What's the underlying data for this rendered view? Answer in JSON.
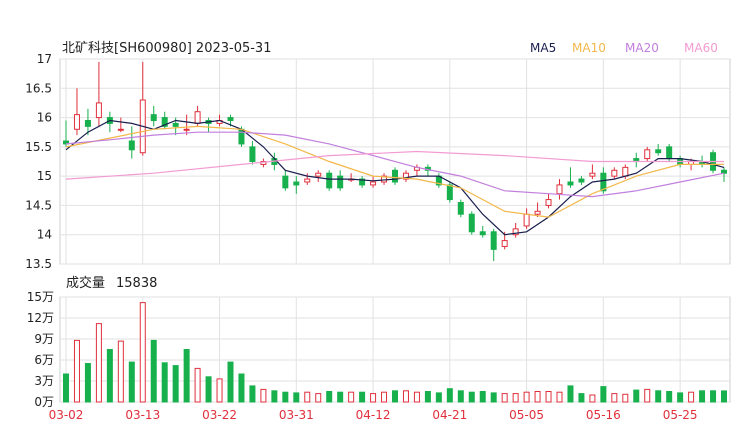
{
  "header": {
    "title": "北矿科技[SH600980] 2023-05-31",
    "legend": [
      {
        "label": "MA5",
        "color": "#1a1f4e"
      },
      {
        "label": "MA10",
        "color": "#f2b84b"
      },
      {
        "label": "MA20",
        "color": "#c27fde"
      },
      {
        "label": "MA60",
        "color": "#f39bd3"
      }
    ]
  },
  "volume_header": {
    "label": "成交量",
    "value": "15838"
  },
  "x_tick_labels": [
    "03-02",
    "03-13",
    "03-22",
    "03-31",
    "04-12",
    "04-21",
    "05-05",
    "05-16",
    "05-25"
  ],
  "colors": {
    "up": "#e0303c",
    "down": "#17b04d",
    "grid": "#e2e2e2",
    "axis": "#222222",
    "date_label": "#e0303c"
  },
  "chart_data": [
    {
      "type": "candlestick",
      "ylim": [
        13.5,
        17
      ],
      "yticks": [
        17,
        16.5,
        16,
        15.5,
        15,
        14.5,
        14,
        13.5
      ],
      "dates": [
        "03-02",
        "03-03",
        "03-06",
        "03-07",
        "03-08",
        "03-09",
        "03-10",
        "03-13",
        "03-14",
        "03-15",
        "03-16",
        "03-17",
        "03-20",
        "03-21",
        "03-22",
        "03-23",
        "03-24",
        "03-27",
        "03-28",
        "03-29",
        "03-30",
        "03-31",
        "04-03",
        "04-04",
        "04-06",
        "04-07",
        "04-10",
        "04-11",
        "04-12",
        "04-13",
        "04-14",
        "04-17",
        "04-18",
        "04-19",
        "04-20",
        "04-21",
        "04-24",
        "04-25",
        "04-26",
        "04-27",
        "04-28",
        "05-04",
        "05-05",
        "05-08",
        "05-09",
        "05-10",
        "05-11",
        "05-12",
        "05-15",
        "05-16",
        "05-17",
        "05-18",
        "05-19",
        "05-22",
        "05-23",
        "05-24",
        "05-25",
        "05-26",
        "05-29",
        "05-30",
        "05-31"
      ],
      "candles": [
        [
          15.6,
          15.55,
          15.95,
          15.5
        ],
        [
          15.8,
          16.05,
          16.5,
          15.7
        ],
        [
          15.95,
          15.85,
          16.15,
          15.7
        ],
        [
          16.0,
          16.25,
          16.95,
          15.85
        ],
        [
          16.0,
          15.9,
          16.1,
          15.75
        ],
        [
          15.8,
          15.8,
          16.0,
          15.75
        ],
        [
          15.6,
          15.45,
          15.85,
          15.3
        ],
        [
          15.4,
          16.3,
          16.95,
          15.35
        ],
        [
          16.05,
          15.95,
          16.2,
          15.85
        ],
        [
          16.0,
          15.85,
          16.1,
          15.8
        ],
        [
          15.9,
          15.85,
          16.0,
          15.7
        ],
        [
          15.8,
          15.8,
          16.05,
          15.7
        ],
        [
          15.9,
          16.1,
          16.2,
          15.85
        ],
        [
          15.95,
          15.9,
          16.0,
          15.75
        ],
        [
          15.9,
          15.95,
          16.05,
          15.85
        ],
        [
          16.0,
          15.95,
          16.05,
          15.85
        ],
        [
          15.8,
          15.55,
          15.85,
          15.5
        ],
        [
          15.5,
          15.25,
          15.6,
          15.2
        ],
        [
          15.2,
          15.25,
          15.3,
          15.15
        ],
        [
          15.3,
          15.2,
          15.4,
          15.1
        ],
        [
          15.0,
          14.8,
          15.1,
          14.75
        ],
        [
          14.9,
          14.85,
          15.0,
          14.7
        ],
        [
          14.9,
          14.95,
          15.05,
          14.85
        ],
        [
          15.0,
          15.05,
          15.1,
          14.9
        ],
        [
          15.05,
          14.8,
          15.1,
          14.75
        ],
        [
          15.0,
          14.8,
          15.1,
          14.75
        ],
        [
          14.95,
          14.95,
          15.05,
          14.9
        ],
        [
          14.95,
          14.85,
          15.0,
          14.8
        ],
        [
          14.85,
          14.9,
          15.0,
          14.8
        ],
        [
          14.9,
          15.0,
          15.05,
          14.85
        ],
        [
          15.1,
          14.9,
          15.15,
          14.85
        ],
        [
          14.95,
          15.05,
          15.1,
          14.9
        ],
        [
          15.1,
          15.15,
          15.2,
          15.0
        ],
        [
          15.15,
          15.1,
          15.2,
          15.0
        ],
        [
          15.0,
          14.85,
          15.05,
          14.8
        ],
        [
          14.85,
          14.6,
          14.9,
          14.55
        ],
        [
          14.55,
          14.35,
          14.6,
          14.3
        ],
        [
          14.35,
          14.05,
          14.4,
          14.0
        ],
        [
          14.05,
          14.0,
          14.15,
          13.95
        ],
        [
          14.05,
          13.75,
          14.1,
          13.55
        ],
        [
          13.8,
          13.9,
          14.05,
          13.75
        ],
        [
          14.0,
          14.1,
          14.2,
          13.95
        ],
        [
          14.15,
          14.35,
          14.45,
          14.1
        ],
        [
          14.35,
          14.4,
          14.55,
          14.3
        ],
        [
          14.5,
          14.6,
          14.7,
          14.45
        ],
        [
          14.7,
          14.85,
          14.95,
          14.6
        ],
        [
          14.9,
          14.85,
          15.15,
          14.8
        ],
        [
          14.95,
          14.9,
          15.0,
          14.85
        ],
        [
          15.0,
          15.05,
          15.2,
          14.95
        ],
        [
          15.05,
          14.75,
          15.15,
          14.7
        ],
        [
          15.0,
          15.1,
          15.15,
          14.95
        ],
        [
          15.0,
          15.15,
          15.2,
          14.95
        ],
        [
          15.3,
          15.25,
          15.4,
          15.15
        ],
        [
          15.3,
          15.45,
          15.5,
          15.25
        ],
        [
          15.45,
          15.4,
          15.55,
          15.35
        ],
        [
          15.5,
          15.3,
          15.55,
          15.25
        ],
        [
          15.3,
          15.2,
          15.35,
          15.15
        ],
        [
          15.2,
          15.25,
          15.3,
          15.1
        ],
        [
          15.25,
          15.2,
          15.35,
          15.15
        ],
        [
          15.4,
          15.1,
          15.45,
          15.05
        ],
        [
          15.1,
          15.05,
          15.15,
          14.9
        ]
      ]
    },
    {
      "type": "line",
      "series": [
        {
          "name": "MA5",
          "color": "#1a1f4e",
          "x": [
            0,
            2,
            4,
            6,
            8,
            10,
            12,
            14,
            16,
            18,
            20,
            22,
            24,
            26,
            28,
            30,
            32,
            34,
            36,
            38,
            40,
            42,
            44,
            46,
            48,
            50,
            52,
            54,
            56,
            58,
            60
          ],
          "y": [
            15.45,
            15.75,
            15.95,
            15.9,
            15.8,
            15.95,
            15.9,
            15.95,
            15.8,
            15.5,
            15.1,
            15.0,
            14.95,
            14.95,
            14.92,
            14.95,
            15.0,
            15.0,
            14.8,
            14.35,
            14.0,
            14.05,
            14.3,
            14.65,
            14.9,
            14.95,
            15.05,
            15.3,
            15.3,
            15.25,
            15.15
          ]
        },
        {
          "name": "MA10",
          "color": "#f2b84b",
          "x": [
            0,
            4,
            8,
            12,
            16,
            20,
            24,
            28,
            32,
            36,
            40,
            44,
            48,
            52,
            56,
            60
          ],
          "y": [
            15.5,
            15.65,
            15.8,
            15.85,
            15.8,
            15.55,
            15.25,
            15.0,
            14.95,
            14.8,
            14.4,
            14.3,
            14.7,
            15.0,
            15.2,
            15.2
          ]
        },
        {
          "name": "MA20",
          "color": "#c27fde",
          "x": [
            0,
            4,
            8,
            12,
            16,
            20,
            24,
            28,
            32,
            36,
            40,
            44,
            48,
            52,
            56,
            60
          ],
          "y": [
            15.55,
            15.62,
            15.7,
            15.75,
            15.75,
            15.7,
            15.55,
            15.35,
            15.15,
            15.0,
            14.75,
            14.7,
            14.65,
            14.75,
            14.9,
            15.05
          ]
        },
        {
          "name": "MA60",
          "color": "#f39bd3",
          "x": [
            0,
            8,
            16,
            24,
            32,
            40,
            48,
            56,
            60
          ],
          "y": [
            14.95,
            15.05,
            15.2,
            15.35,
            15.42,
            15.35,
            15.25,
            15.25,
            15.25
          ]
        }
      ]
    },
    {
      "type": "bar",
      "name": "成交量",
      "ylim": [
        0,
        150000
      ],
      "yticks": [
        "15万",
        "12万",
        "9万",
        "6万",
        "3万",
        "0万"
      ],
      "values": [
        40000,
        88000,
        55000,
        112000,
        75000,
        87000,
        57000,
        142000,
        88000,
        56000,
        52000,
        75000,
        48000,
        36000,
        33000,
        57000,
        40000,
        23000,
        18000,
        16000,
        14000,
        13000,
        14000,
        12000,
        15000,
        14000,
        14000,
        14000,
        12000,
        14000,
        16000,
        16000,
        14000,
        15000,
        13000,
        19000,
        16000,
        14000,
        15000,
        13000,
        12000,
        12000,
        14000,
        15000,
        15000,
        14000,
        23000,
        12000,
        10000,
        22000,
        12000,
        11000,
        17000,
        18000,
        16000,
        15000,
        13000,
        14000,
        16000,
        16000,
        15838
      ],
      "up": [
        0,
        1,
        0,
        1,
        0,
        1,
        0,
        1,
        0,
        0,
        0,
        0,
        1,
        0,
        1,
        0,
        0,
        0,
        1,
        0,
        0,
        0,
        1,
        1,
        0,
        0,
        1,
        0,
        1,
        1,
        0,
        1,
        1,
        0,
        0,
        0,
        0,
        0,
        0,
        0,
        1,
        1,
        1,
        1,
        1,
        1,
        0,
        0,
        1,
        0,
        1,
        1,
        0,
        1,
        0,
        0,
        0,
        1,
        0,
        0,
        0
      ]
    }
  ]
}
